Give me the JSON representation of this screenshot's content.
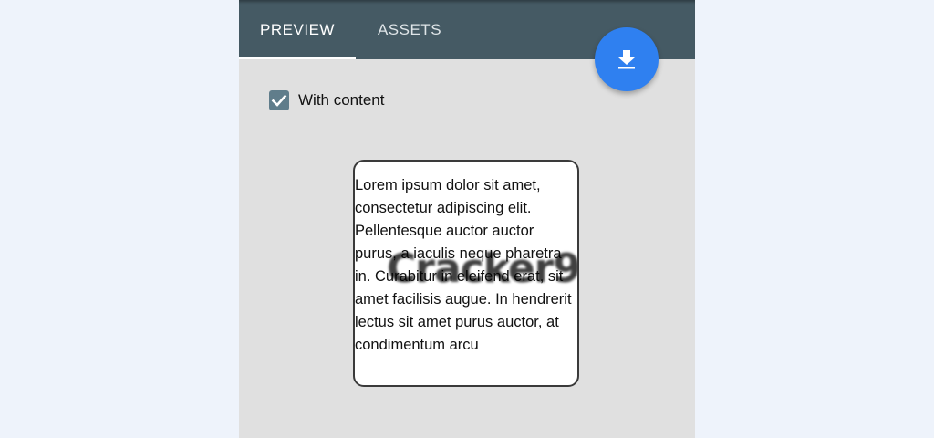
{
  "tabs": [
    {
      "label": "PREVIEW",
      "active": true
    },
    {
      "label": "ASSETS",
      "active": false
    }
  ],
  "fab": {
    "icon": "download-icon",
    "color": "#2f80f0"
  },
  "options": {
    "with_content": {
      "label": "With content",
      "checked": true
    }
  },
  "preview_card": {
    "text": "Lorem ipsum dolor sit amet, consectetur adipiscing elit. Pellentesque auctor auctor purus, a iaculis neque pharetra in. Curabitur in eleifend erat, sit amet facilisis augue. In hendrerit lectus sit amet purus auctor, at condimentum arcu",
    "watermark": "Cracker9"
  },
  "colors": {
    "tabbar": "#455a64",
    "panel": "#e0e0e0",
    "background": "#eef3fb",
    "checkbox": "#607d8b"
  }
}
